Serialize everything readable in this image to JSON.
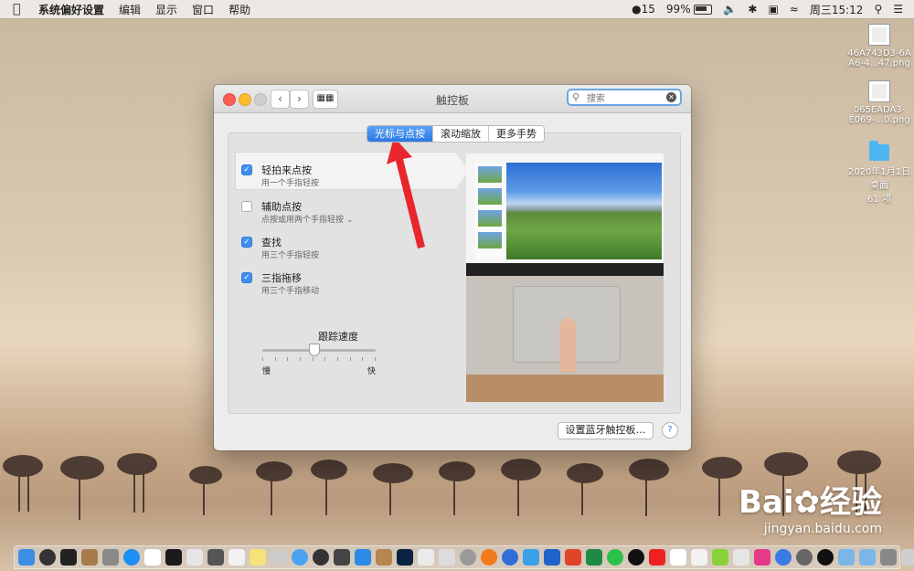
{
  "menubar": {
    "app_name": "系统偏好设置",
    "items": [
      "编辑",
      "显示",
      "窗口",
      "帮助"
    ],
    "status": {
      "qq_count": "15",
      "battery": "99%",
      "datetime": "周三15:12"
    }
  },
  "desktop_icons": [
    {
      "label_line1": "46A743D3-6A",
      "label_line2": "A6-4...47.png"
    },
    {
      "label_line1": "065EADA3-",
      "label_line2": "E069-...0.png"
    },
    {
      "label_line1": "2020年1月1日",
      "label_line2": "桌面",
      "label_line3": "61 项"
    }
  ],
  "window": {
    "title": "触控板",
    "search_placeholder": "搜索",
    "tabs": [
      {
        "label": "光标与点按",
        "active": true
      },
      {
        "label": "滚动缩放",
        "active": false
      },
      {
        "label": "更多手势",
        "active": false
      }
    ],
    "options": [
      {
        "title": "轻拍来点按",
        "subtitle": "用一个手指轻按",
        "checked": true
      },
      {
        "title": "辅助点按",
        "subtitle": "点按或用两个手指轻按",
        "checked": false
      },
      {
        "title": "查找",
        "subtitle": "用三个手指轻按",
        "checked": true
      },
      {
        "title": "三指拖移",
        "subtitle": "用三个手指移动",
        "checked": true
      }
    ],
    "tracking_speed": {
      "label": "跟踪速度",
      "slow": "慢",
      "fast": "快",
      "value": 0.45
    },
    "bluetooth_button": "设置蓝牙触控板…",
    "help_label": "?"
  },
  "watermark": {
    "brand": "Bai",
    "brand_cn": "经验",
    "url": "jingyan.baidu.com"
  },
  "colors": {
    "accent": "#2b78e4",
    "annotation": "#e8262b"
  }
}
